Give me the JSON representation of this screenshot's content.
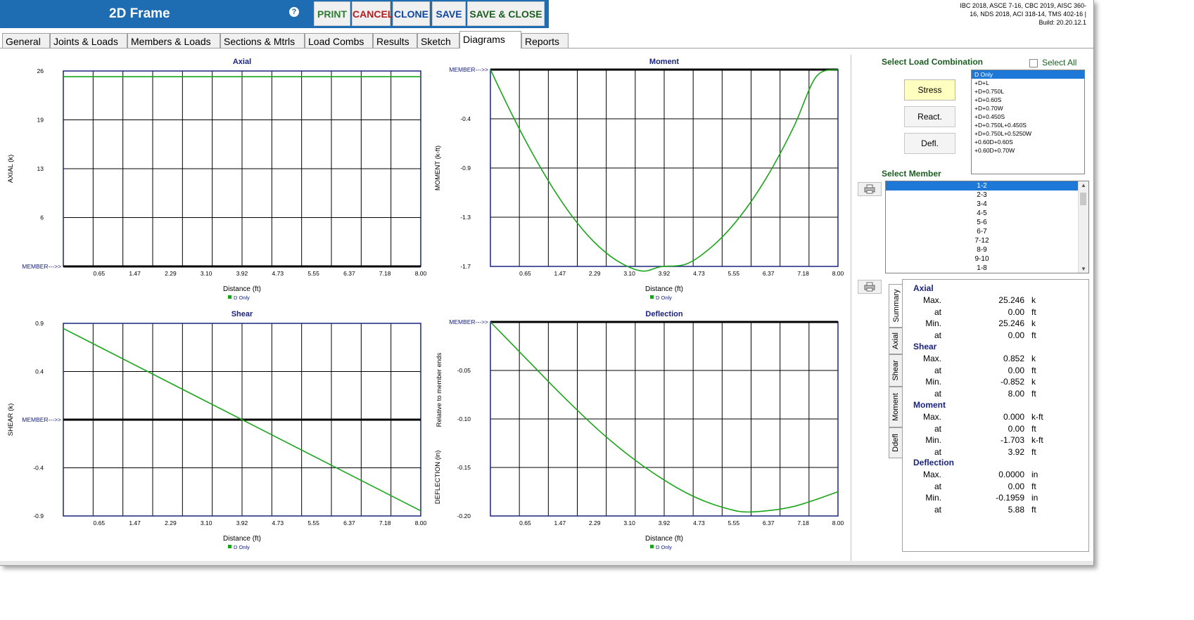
{
  "header": {
    "title": "2D Frame",
    "help_icon": "question-circle-icon",
    "buttons": {
      "print": "PRINT",
      "cancel": "CANCEL",
      "clone": "CLONE",
      "save": "SAVE",
      "save_close": "SAVE & CLOSE"
    },
    "build_info_line1": "IBC 2018, ASCE 7-16, CBC 2019, AISC 360-",
    "build_info_line2": "16, NDS 2018, ACI 318-14, TMS 402-16 |",
    "build_info_line3": "Build: 20.20.12.1"
  },
  "tabs": [
    {
      "label": "General"
    },
    {
      "label": "Joints & Loads"
    },
    {
      "label": "Members & Loads"
    },
    {
      "label": "Sections & Mtrls"
    },
    {
      "label": "Load Combs"
    },
    {
      "label": "Results"
    },
    {
      "label": "Sketch"
    },
    {
      "label": "Diagrams",
      "active": true
    },
    {
      "label": "Reports"
    }
  ],
  "colors": {
    "series": "#1aa51a",
    "frame": "#1a237e",
    "header_bg": "#1e6db3",
    "selected": "#1e78d7"
  },
  "chart_data": [
    {
      "type": "line",
      "title": "Axial",
      "ylabel": "AXIAL   (k)",
      "xlabel": "Distance (ft)",
      "legend": "D Only",
      "legend_position": "bottom",
      "x_ticks": [
        "0.65",
        "1.47",
        "2.29",
        "3.10",
        "3.92",
        "4.73",
        "5.55",
        "6.37",
        "7.18",
        "8.00"
      ],
      "y_ticks": [
        "26",
        "19",
        "13",
        "6"
      ],
      "ylim": [
        0,
        26
      ],
      "member_marker": "MEMBER--->>",
      "member_line_value": 0,
      "grid": true,
      "series": [
        {
          "name": "D Only",
          "x": [
            0,
            8
          ],
          "y": [
            25.246,
            25.246
          ]
        }
      ]
    },
    {
      "type": "line",
      "title": "Moment",
      "ylabel": "MOMENT   (k-ft)",
      "xlabel": "Distance (ft)",
      "legend": "D Only",
      "legend_position": "bottom",
      "x_ticks": [
        "0.65",
        "1.47",
        "2.29",
        "3.10",
        "3.92",
        "4.73",
        "5.55",
        "6.37",
        "7.18",
        "8.00"
      ],
      "y_ticks": [
        "-0.4",
        "-0.9",
        "-1.3",
        "-1.7"
      ],
      "ylim": [
        -1.7,
        0
      ],
      "member_marker": "MEMBER--->>",
      "member_line_value": 0,
      "grid": true,
      "series": [
        {
          "name": "D Only",
          "x": [
            0,
            0.5,
            1,
            1.5,
            2,
            2.5,
            3,
            3.5,
            3.92,
            4.5,
            5,
            5.5,
            6,
            6.5,
            7,
            7.5,
            8
          ],
          "y": [
            0,
            -0.39,
            -0.745,
            -1.06,
            -1.325,
            -1.53,
            -1.67,
            -1.74,
            -1.703,
            -1.68,
            -1.56,
            -1.38,
            -1.14,
            -0.84,
            -0.48,
            -0.06,
            0.0
          ]
        }
      ]
    },
    {
      "type": "line",
      "title": "Shear",
      "ylabel": "SHEAR   (k)",
      "xlabel": "Distance (ft)",
      "legend": "D Only",
      "legend_position": "bottom",
      "x_ticks": [
        "0.65",
        "1.47",
        "2.29",
        "3.10",
        "3.92",
        "4.73",
        "5.55",
        "6.37",
        "7.18",
        "8.00"
      ],
      "y_ticks": [
        "0.9",
        "0.4",
        "-0.4",
        "-0.9"
      ],
      "ylim": [
        -0.9,
        0.9
      ],
      "member_marker": "MEMBER--->>",
      "member_line_value": 0,
      "grid": true,
      "series": [
        {
          "name": "D Only",
          "x": [
            0,
            8
          ],
          "y": [
            0.852,
            -0.852
          ]
        }
      ]
    },
    {
      "type": "line",
      "title": "Deflection",
      "ylabel": "DEFLECTION   (in)",
      "ylabel2": "Relative to member ends",
      "xlabel": "Distance (ft)",
      "legend": "D Only",
      "legend_position": "bottom",
      "x_ticks": [
        "0.65",
        "1.47",
        "2.29",
        "3.10",
        "3.92",
        "4.73",
        "5.55",
        "6.37",
        "7.18",
        "8.00"
      ],
      "y_ticks": [
        "-0.05",
        "-0.10",
        "-0.15",
        "-0.20"
      ],
      "ylim": [
        -0.2,
        0
      ],
      "member_marker": "MEMBER--->>",
      "member_line_value": 0,
      "grid": true,
      "series": [
        {
          "name": "D Only",
          "x": [
            0,
            0.5,
            1,
            1.5,
            2,
            2.5,
            3,
            3.5,
            4,
            4.5,
            5,
            5.5,
            5.88,
            6.5,
            7,
            7.5,
            8
          ],
          "y": [
            0,
            -0.023,
            -0.046,
            -0.069,
            -0.091,
            -0.112,
            -0.131,
            -0.148,
            -0.163,
            -0.176,
            -0.186,
            -0.193,
            -0.1959,
            -0.194,
            -0.19,
            -0.183,
            -0.175
          ]
        }
      ]
    }
  ],
  "right_panel": {
    "select_load_combination_title": "Select Load Combination",
    "select_all_label": "Select All",
    "buttons": {
      "stress": "Stress",
      "react": "React.",
      "defl": "Defl."
    },
    "load_combinations": [
      "D Only",
      "+D+L",
      "+D+0.750L",
      "+D+0.60S",
      "+D+0.70W",
      "+D+0.450S",
      "+D+0.750L+0.450S",
      "+D+0.750L+0.5250W",
      "+0.60D+0.60S",
      "+0.60D+0.70W"
    ],
    "selected_load_combination": 0,
    "select_member_title": "Select Member",
    "members": [
      "1-2",
      "2-3",
      "3-4",
      "4-5",
      "5-6",
      "6-7",
      "7-12",
      "8-9",
      "9-10",
      "1-8"
    ],
    "selected_member": 0,
    "print_icon": "printer-icon",
    "vertical_tabs": [
      "Summary",
      "Axial",
      "Shear",
      "Moment",
      "Ddefl"
    ],
    "summary": {
      "axial": {
        "head": "Axial",
        "max_label": "Max.",
        "max": "25.246",
        "max_unit": "k",
        "at1_label": "at",
        "at1": "0.00",
        "at1_unit": "ft",
        "min_label": "Min.",
        "min": "25.246",
        "min_unit": "k",
        "at2_label": "at",
        "at2": "0.00",
        "at2_unit": "ft"
      },
      "shear": {
        "head": "Shear",
        "max_label": "Max.",
        "max": "0.852",
        "max_unit": "k",
        "at1_label": "at",
        "at1": "0.00",
        "at1_unit": "ft",
        "min_label": "Min.",
        "min": "-0.852",
        "min_unit": "k",
        "at2_label": "at",
        "at2": "8.00",
        "at2_unit": "ft"
      },
      "moment": {
        "head": "Moment",
        "max_label": "Max.",
        "max": "0.000",
        "max_unit": "k-ft",
        "at1_label": "at",
        "at1": "0.00",
        "at1_unit": "ft",
        "min_label": "Min.",
        "min": "-1.703",
        "min_unit": "k-ft",
        "at2_label": "at",
        "at2": "3.92",
        "at2_unit": "ft"
      },
      "deflection": {
        "head": "Deflection",
        "max_label": "Max.",
        "max": "0.0000",
        "max_unit": "in",
        "at1_label": "at",
        "at1": "0.00",
        "at1_unit": "ft",
        "min_label": "Min.",
        "min": "-0.1959",
        "min_unit": "in",
        "at2_label": "at",
        "at2": "5.88",
        "at2_unit": "ft"
      }
    }
  }
}
